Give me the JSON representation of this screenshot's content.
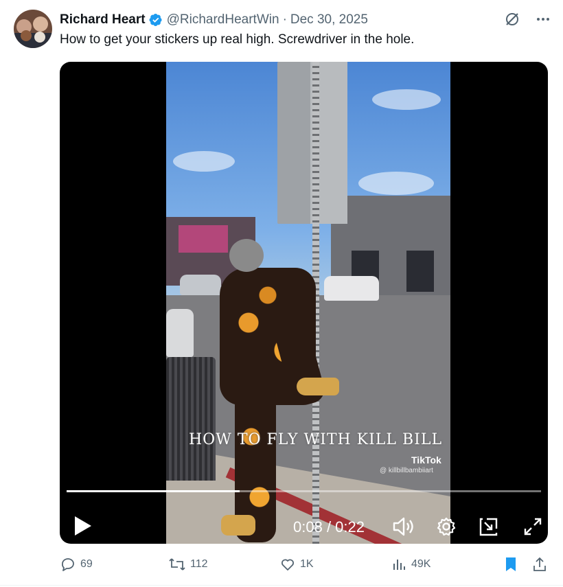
{
  "tweet": {
    "author_name": "Richard Heart",
    "handle": "@RichardHeartWin",
    "separator": "·",
    "date": "Dec 30, 2025",
    "text": "How to get your stickers up real high. Screwdriver in the hole."
  },
  "colors": {
    "verified": "#1d9bf0",
    "bookmark": "#1d9bf0",
    "secondary_text": "#536471"
  },
  "video": {
    "caption_overlay": "HOW TO FLY WITH KILL BILL",
    "watermark_brand": "TikTok",
    "watermark_user": "@ killbillbambiiart",
    "current_time": "0:08",
    "time_separator": " / ",
    "duration": "0:22",
    "progress_fraction": 0.364,
    "controls": [
      "play-icon",
      "volume-icon",
      "settings-gear-icon",
      "pop-out-icon",
      "fullscreen-icon"
    ]
  },
  "actions": {
    "replies": "69",
    "reposts": "112",
    "likes": "1K",
    "views": "49K"
  }
}
